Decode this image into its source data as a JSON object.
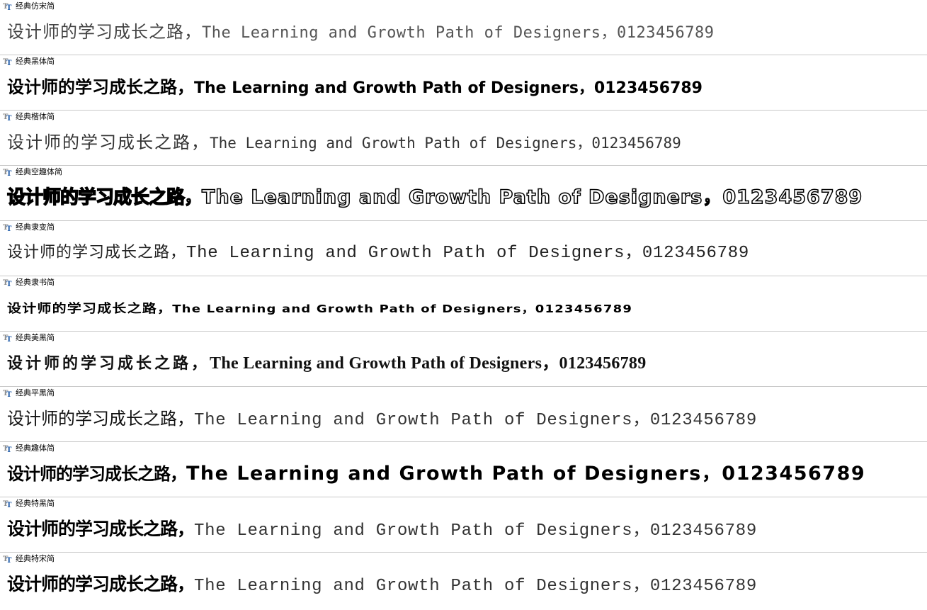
{
  "colors": {
    "background": "#ffffff",
    "divider": "#c8c8c8",
    "icon_blue": "#1e5aa8",
    "icon_gray": "#8a8a8a"
  },
  "icon": "truetype-font-icon",
  "fonts": [
    {
      "name": "经典仿宋简",
      "sample_cn": "设计师的学习成长之路，",
      "sample_en": "The Learning and Growth Path of Designers，0123456789",
      "style": "s1"
    },
    {
      "name": "经典黑体简",
      "sample_cn": "设计师的学习成长之路，",
      "sample_en": "The Learning and Growth Path of Designers，0123456789",
      "style": "s2"
    },
    {
      "name": "经典楷体简",
      "sample_cn": "设计师的学习成长之路，",
      "sample_en": "The Learning and Growth Path of Designers，0123456789",
      "style": "s3"
    },
    {
      "name": "经典空趣体简",
      "sample_cn": "设计师的学习成长之路，",
      "sample_en": "The Learning and Growth Path of Designers，0123456789",
      "style": "s4"
    },
    {
      "name": "经典隶变简",
      "sample_cn": "设计师的学习成长之路，",
      "sample_en": "The Learning and Growth Path of Designers，0123456789",
      "style": "s5"
    },
    {
      "name": "经典隶书简",
      "sample_cn": "设计师的学习成长之路，",
      "sample_en": "The Learning and Growth Path of Designers，0123456789",
      "style": "s6"
    },
    {
      "name": "经典美黑简",
      "sample_cn": "设计师的学习成长之路，",
      "sample_en": "The Learning and Growth Path of Designers，0123456789",
      "style": "s7"
    },
    {
      "name": "经典平黑简",
      "sample_cn": "设计师的学习成长之路，",
      "sample_en": "The Learning and Growth Path of Designers，0123456789",
      "style": "s8"
    },
    {
      "name": "经典趣体简",
      "sample_cn": "设计师的学习成长之路，",
      "sample_en": "The Learning and Growth Path of Designers，0123456789",
      "style": "s9"
    },
    {
      "name": "经典特黑简",
      "sample_cn": "设计师的学习成长之路，",
      "sample_en": "The Learning and Growth Path of Designers，0123456789",
      "style": "s10"
    },
    {
      "name": "经典特宋简",
      "sample_cn": "设计师的学习成长之路，",
      "sample_en": "The Learning and Growth Path of Designers，0123456789",
      "style": "s11"
    }
  ]
}
